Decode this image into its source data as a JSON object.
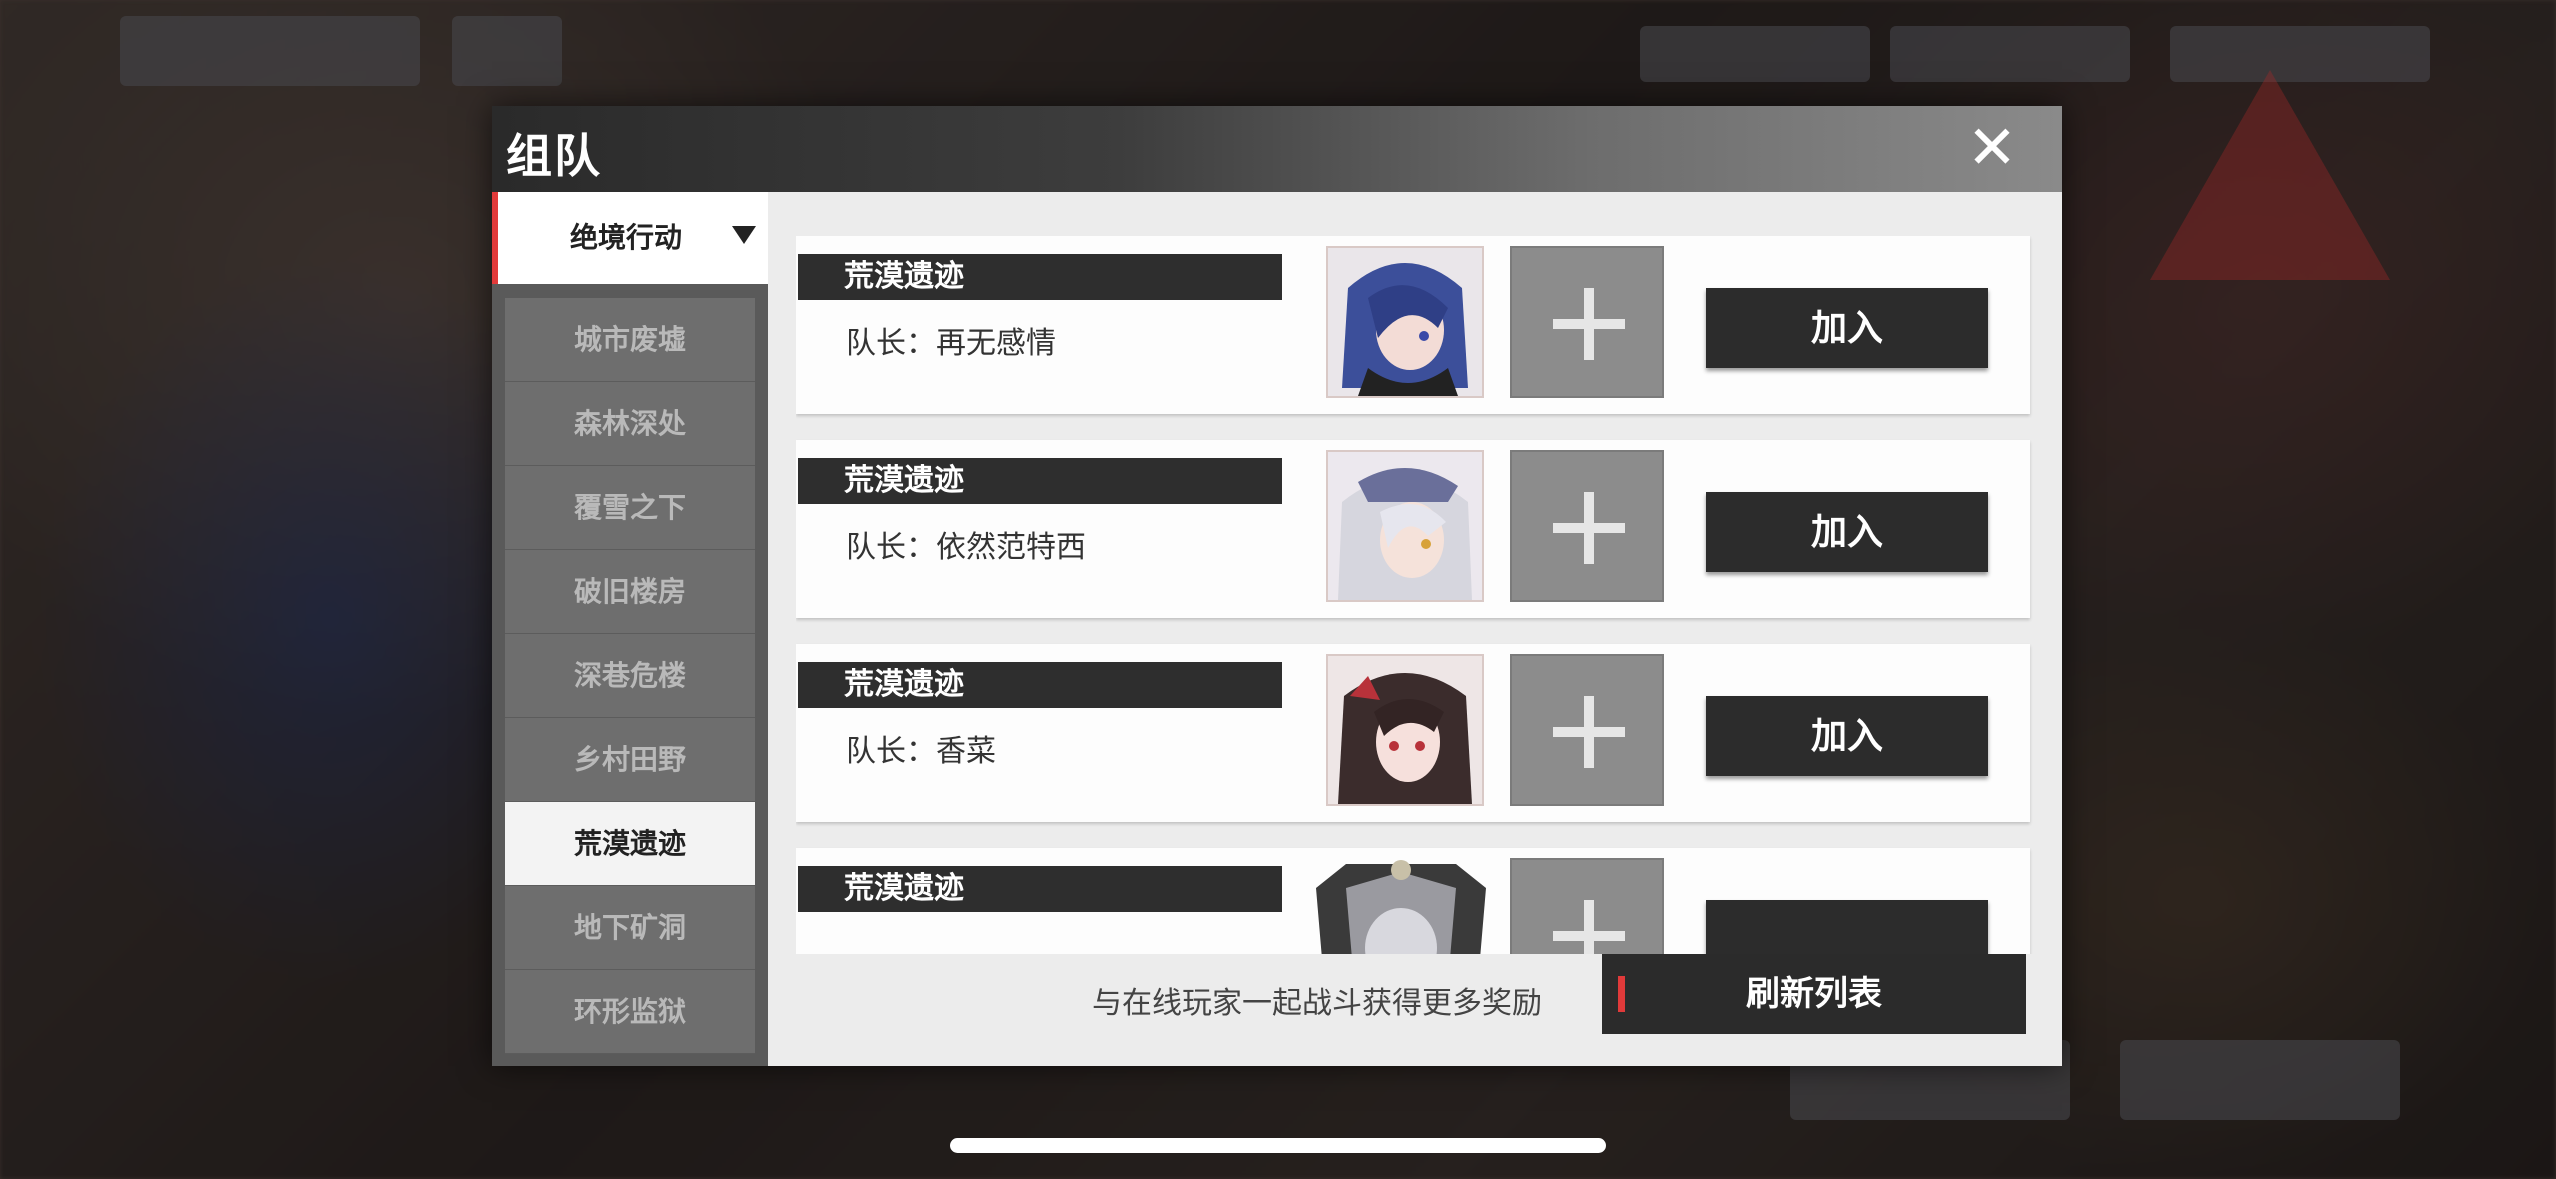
{
  "window": {
    "title": "组队",
    "close_label": "✕"
  },
  "sidebar": {
    "selected_category": "绝境行动",
    "items": [
      {
        "label": "城市废墟",
        "active": false
      },
      {
        "label": "森林深处",
        "active": false
      },
      {
        "label": "覆雪之下",
        "active": false
      },
      {
        "label": "破旧楼房",
        "active": false
      },
      {
        "label": "深巷危楼",
        "active": false
      },
      {
        "label": "乡村田野",
        "active": false
      },
      {
        "label": "荒漠遗迹",
        "active": true
      },
      {
        "label": "地下矿洞",
        "active": false
      },
      {
        "label": "环形监狱",
        "active": false
      }
    ]
  },
  "teams": [
    {
      "zone": "荒漠遗迹",
      "leader": "队长：再无感情",
      "join_label": "加入",
      "avatar": "blue-hair-avatar"
    },
    {
      "zone": "荒漠遗迹",
      "leader": "队长：依然范特西",
      "join_label": "加入",
      "avatar": "white-hair-avatar"
    },
    {
      "zone": "荒漠遗迹",
      "leader": "队长：香菜",
      "join_label": "加入",
      "avatar": "dark-hair-avatar"
    },
    {
      "zone": "荒漠遗迹",
      "leader": "",
      "join_label": "",
      "avatar": "armored-avatar"
    }
  ],
  "footer": {
    "hint": "与在线玩家一起战斗获得更多奖励",
    "refresh_label": "刷新列表"
  },
  "colors": {
    "accent_red": "#e23a3a",
    "button_dark": "#2c2c2c",
    "panel_light": "#f1f1f1"
  }
}
